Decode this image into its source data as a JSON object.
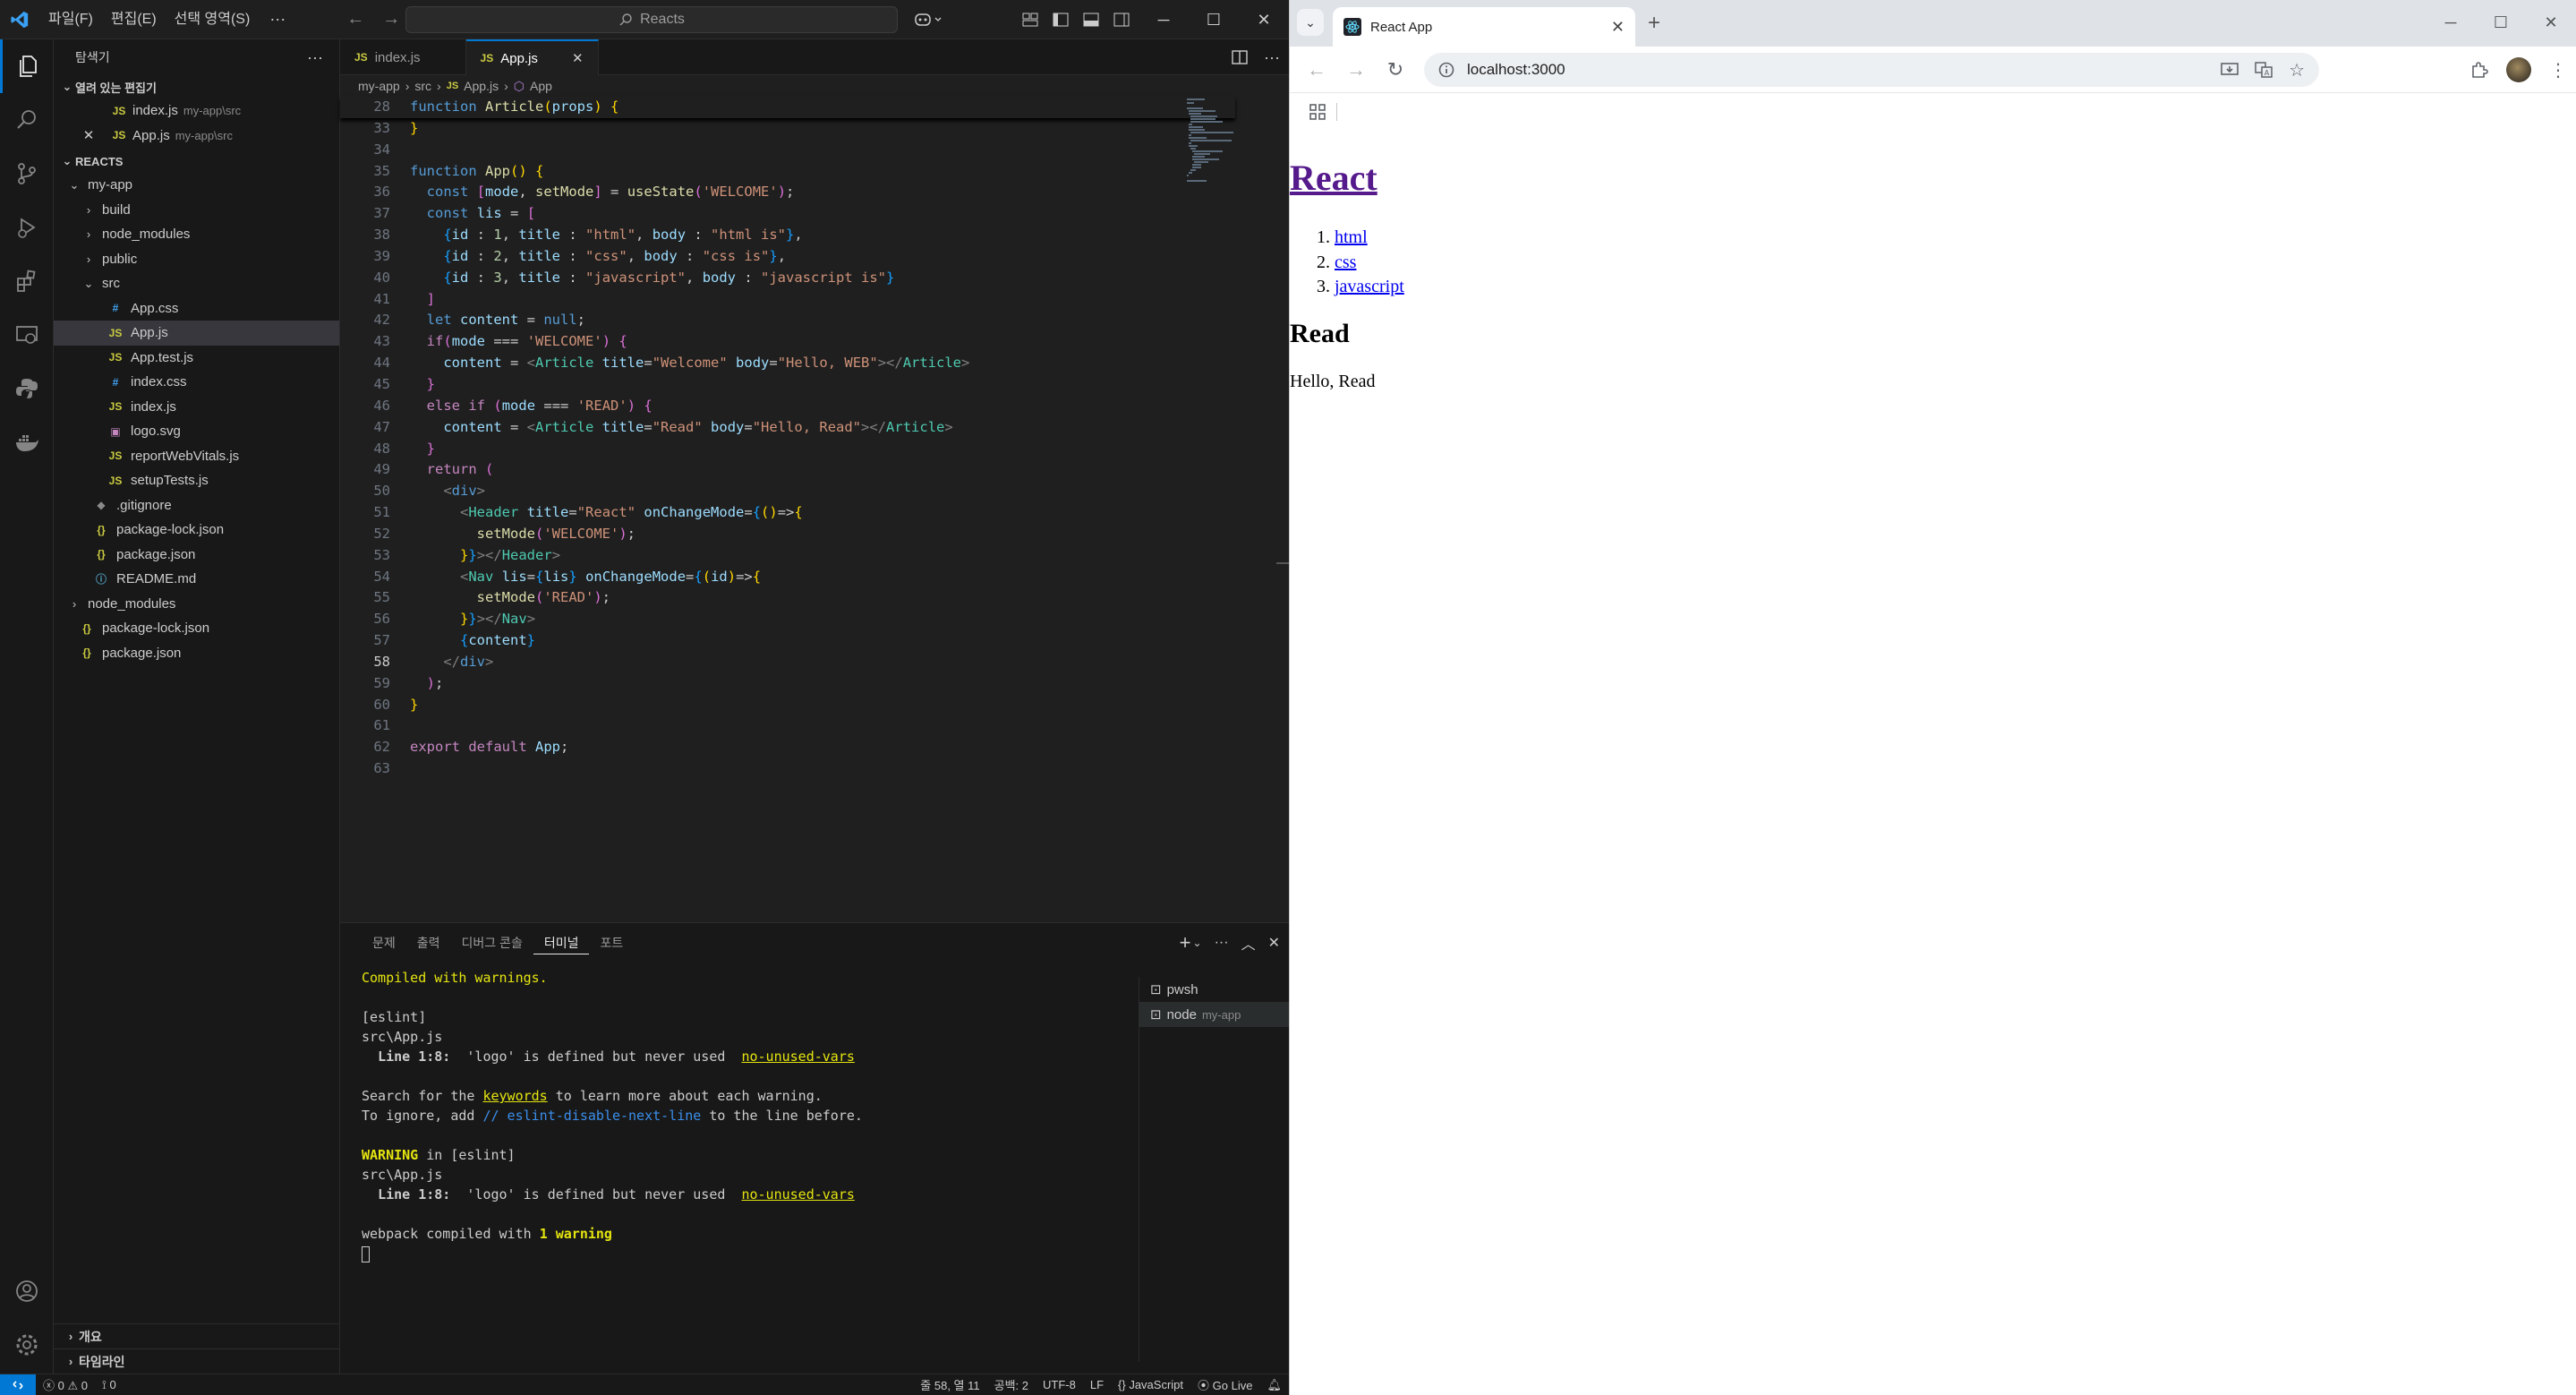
{
  "vscode": {
    "menu": [
      "파일(F)",
      "편집(E)",
      "선택 영역(S)"
    ],
    "command_center": "Reacts",
    "sidebar": {
      "title": "탐색기",
      "open_editors_title": "열려 있는 편집기",
      "open_editors": [
        {
          "name": "index.js",
          "desc": "my-app\\src"
        },
        {
          "name": "App.js",
          "desc": "my-app\\src"
        }
      ],
      "workspace_title": "REACTS",
      "tree": [
        {
          "label": "my-app",
          "kind": "folder-open",
          "depth": 0
        },
        {
          "label": "build",
          "kind": "folder",
          "depth": 1
        },
        {
          "label": "node_modules",
          "kind": "folder",
          "depth": 1
        },
        {
          "label": "public",
          "kind": "folder",
          "depth": 1
        },
        {
          "label": "src",
          "kind": "folder-open",
          "depth": 1
        },
        {
          "label": "App.css",
          "kind": "css",
          "depth": 2
        },
        {
          "label": "App.js",
          "kind": "js",
          "depth": 2,
          "active": true
        },
        {
          "label": "App.test.js",
          "kind": "js",
          "depth": 2
        },
        {
          "label": "index.css",
          "kind": "css",
          "depth": 2
        },
        {
          "label": "index.js",
          "kind": "js",
          "depth": 2
        },
        {
          "label": "logo.svg",
          "kind": "svg",
          "depth": 2
        },
        {
          "label": "reportWebVitals.js",
          "kind": "js",
          "depth": 2
        },
        {
          "label": "setupTests.js",
          "kind": "js",
          "depth": 2
        },
        {
          "label": ".gitignore",
          "kind": "git",
          "depth": 1
        },
        {
          "label": "package-lock.json",
          "kind": "json",
          "depth": 1
        },
        {
          "label": "package.json",
          "kind": "json",
          "depth": 1
        },
        {
          "label": "README.md",
          "kind": "md",
          "depth": 1
        },
        {
          "label": "node_modules",
          "kind": "folder",
          "depth": 0
        },
        {
          "label": "package-lock.json",
          "kind": "json",
          "depth": 0
        },
        {
          "label": "package.json",
          "kind": "json",
          "depth": 0
        }
      ],
      "outline_title": "개요",
      "timeline_title": "타임라인"
    },
    "tabs": [
      {
        "label": "index.js",
        "active": false
      },
      {
        "label": "App.js",
        "active": true
      }
    ],
    "breadcrumb": [
      "my-app",
      "src",
      "App.js",
      "App"
    ],
    "code_lines": [
      {
        "n": "28",
        "html": "<span class='kw'>function</span> <span class='fn'>Article</span><span class='brk'>(</span><span class='var'>props</span><span class='brk'>)</span> <span class='brk'>{</span>",
        "sticky": true
      },
      {
        "n": "33",
        "html": "<span class='brk'>}</span>"
      },
      {
        "n": "34",
        "html": ""
      },
      {
        "n": "35",
        "html": "<span class='kw'>function</span> <span class='fn'>App</span><span class='brk'>()</span> <span class='brk'>{</span>"
      },
      {
        "n": "36",
        "html": "  <span class='kw'>const</span> <span class='brk2'>[</span><span class='var'>mode</span>, <span class='fn'>setMode</span><span class='brk2'>]</span> = <span class='fn'>useState</span><span class='brk2'>(</span><span class='str'>'WELCOME'</span><span class='brk2'>)</span>;"
      },
      {
        "n": "37",
        "html": "  <span class='kw'>const</span> <span class='var'>lis</span> = <span class='brk2'>[</span>"
      },
      {
        "n": "38",
        "html": "    <span class='brk3'>{</span><span class='var'>id</span> : <span class='num2'>1</span>, <span class='var'>title</span> : <span class='str'>\"html\"</span>, <span class='var'>body</span> : <span class='str'>\"html is\"</span><span class='brk3'>}</span>,"
      },
      {
        "n": "39",
        "html": "    <span class='brk3'>{</span><span class='var'>id</span> : <span class='num2'>2</span>, <span class='var'>title</span> : <span class='str'>\"css\"</span>, <span class='var'>body</span> : <span class='str'>\"css is\"</span><span class='brk3'>}</span>,"
      },
      {
        "n": "40",
        "html": "    <span class='brk3'>{</span><span class='var'>id</span> : <span class='num2'>3</span>, <span class='var'>title</span> : <span class='str'>\"javascript\"</span>, <span class='var'>body</span> : <span class='str'>\"javascript is\"</span><span class='brk3'>}</span>"
      },
      {
        "n": "41",
        "html": "  <span class='brk2'>]</span>"
      },
      {
        "n": "42",
        "html": "  <span class='kw'>let</span> <span class='var'>content</span> = <span class='kw'>null</span>;"
      },
      {
        "n": "43",
        "html": "  <span class='kw2'>if</span><span class='brk2'>(</span><span class='var'>mode</span> === <span class='str'>'WELCOME'</span><span class='brk2'>)</span> <span class='brk2'>{</span>"
      },
      {
        "n": "44",
        "html": "    <span class='var'>content</span> = <span class='dim'>&lt;</span><span class='tag'>Article</span> <span class='var'>title</span>=<span class='str'>\"Welcome\"</span> <span class='var'>body</span>=<span class='str'>\"Hello, WEB\"</span><span class='dim'>&gt;&lt;/</span><span class='tag'>Article</span><span class='dim'>&gt;</span>"
      },
      {
        "n": "45",
        "html": "  <span class='brk2'>}</span>"
      },
      {
        "n": "46",
        "html": "  <span class='kw2'>else</span> <span class='kw2'>if</span> <span class='brk2'>(</span><span class='var'>mode</span> === <span class='str'>'READ'</span><span class='brk2'>)</span> <span class='brk2'>{</span>"
      },
      {
        "n": "47",
        "html": "    <span class='var'>content</span> = <span class='dim'>&lt;</span><span class='tag'>Article</span> <span class='var'>title</span>=<span class='str'>\"Read\"</span> <span class='var'>body</span>=<span class='str'>\"Hello, Read\"</span><span class='dim'>&gt;&lt;/</span><span class='tag'>Article</span><span class='dim'>&gt;</span>"
      },
      {
        "n": "48",
        "html": "  <span class='brk2'>}</span>"
      },
      {
        "n": "49",
        "html": "  <span class='kw2'>return</span> <span class='brk2'>(</span>"
      },
      {
        "n": "50",
        "html": "    <span class='dim'>&lt;</span><span class='kw'>div</span><span class='dim'>&gt;</span>"
      },
      {
        "n": "51",
        "html": "      <span class='dim'>&lt;</span><span class='tag'>Header</span> <span class='var'>title</span>=<span class='str'>\"React\"</span> <span class='var'>onChangeMode</span>=<span class='brk3'>{</span><span class='brk'>()</span>=&gt;<span class='brk'>{</span>"
      },
      {
        "n": "52",
        "html": "        <span class='fn'>setMode</span><span class='brk2'>(</span><span class='str'>'WELCOME'</span><span class='brk2'>)</span>;"
      },
      {
        "n": "53",
        "html": "      <span class='brk'>}</span><span class='brk3'>}</span><span class='dim'>&gt;&lt;/</span><span class='tag'>Header</span><span class='dim'>&gt;</span>"
      },
      {
        "n": "54",
        "html": "      <span class='dim'>&lt;</span><span class='tag'>Nav</span> <span class='var'>lis</span>=<span class='brk3'>{</span><span class='var'>lis</span><span class='brk3'>}</span> <span class='var'>onChangeMode</span>=<span class='brk3'>{</span><span class='brk'>(</span><span class='var'>id</span><span class='brk'>)</span>=&gt;<span class='brk'>{</span>"
      },
      {
        "n": "55",
        "html": "        <span class='fn'>setMode</span><span class='brk2'>(</span><span class='str'>'READ'</span><span class='brk2'>)</span>;"
      },
      {
        "n": "56",
        "html": "      <span class='brk'>}</span><span class='brk3'>}</span><span class='dim'>&gt;&lt;/</span><span class='tag'>Nav</span><span class='dim'>&gt;</span>"
      },
      {
        "n": "57",
        "html": "      <span class='brk3'>{</span><span class='var'>content</span><span class='brk3'>}</span>"
      },
      {
        "n": "58",
        "html": "    <span class='dim'>&lt;/</span><span class='kw'>div</span><span class='dim'>&gt;</span>",
        "current": true
      },
      {
        "n": "59",
        "html": "  <span class='brk2'>)</span>;"
      },
      {
        "n": "60",
        "html": "<span class='brk'>}</span>"
      },
      {
        "n": "61",
        "html": ""
      },
      {
        "n": "62",
        "html": "<span class='kw2'>export</span> <span class='kw2'>default</span> <span class='var'>App</span>;"
      },
      {
        "n": "63",
        "html": ""
      }
    ],
    "panel_tabs": [
      {
        "label": "문제",
        "active": false
      },
      {
        "label": "출력",
        "active": false
      },
      {
        "label": "디버그 콘솔",
        "active": false
      },
      {
        "label": "터미널",
        "active": true
      },
      {
        "label": "포트",
        "active": false
      }
    ],
    "terminal_lines": [
      {
        "html": "<span class='yel'>Compiled with warnings.</span>"
      },
      {
        "html": ""
      },
      {
        "html": "[eslint]"
      },
      {
        "html": "src\\App.js"
      },
      {
        "html": "  <span class='bold'>Line 1:8:</span>  'logo' is defined but never used  <span class='link'>no-unused-vars</span>"
      },
      {
        "html": ""
      },
      {
        "html": "Search for the <span class='link'>keywords</span> to learn more about each warning."
      },
      {
        "html": "To ignore, add <span class='blue'>// eslint-disable-next-line</span> to the line before."
      },
      {
        "html": ""
      },
      {
        "html": "<span class='yel bold'>WARNING</span> in [eslint]"
      },
      {
        "html": "src\\App.js"
      },
      {
        "html": "  <span class='bold'>Line 1:8:</span>  'logo' is defined but never used  <span class='link'>no-unused-vars</span>"
      },
      {
        "html": ""
      },
      {
        "html": "webpack compiled with <span class='yel bold'>1 warning</span>"
      },
      {
        "html": "<span class='cursor'></span>"
      }
    ],
    "terminals": [
      {
        "name": "pwsh",
        "sub": ""
      },
      {
        "name": "node",
        "sub": "my-app"
      }
    ],
    "status": {
      "errors": "0",
      "warnings": "0",
      "ports": "0",
      "position": "줄 58, 열 11",
      "spaces": "공백: 2",
      "encoding": "UTF-8",
      "eol": "LF",
      "language": "JavaScript",
      "golive": "Go Live"
    }
  },
  "chrome": {
    "tab_title": "React App",
    "url": "localhost:3000",
    "page": {
      "heading": "React",
      "nav": [
        "html",
        "css",
        "javascript"
      ],
      "article_title": "Read",
      "article_body": "Hello, Read"
    }
  },
  "colors": {
    "accent": "#0078d4",
    "link_visited": "#551a8b",
    "link": "#0000ee"
  }
}
